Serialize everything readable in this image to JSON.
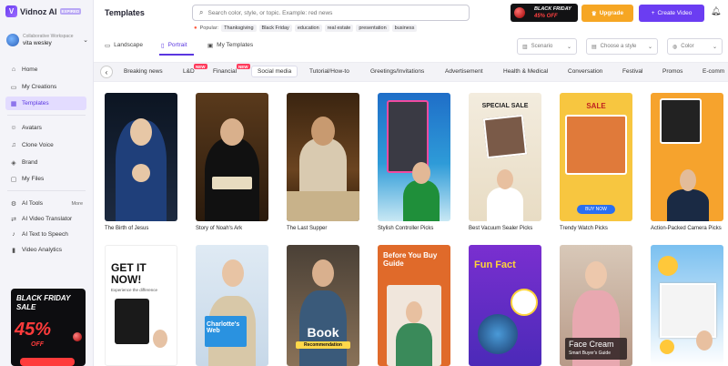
{
  "app": {
    "brand": "Vidnoz AI",
    "brand_badge": "EXPIRED",
    "workspace_label": "Collaborative Workspace",
    "user_name": "vita wesley"
  },
  "sidebar": {
    "items": [
      {
        "label": "Home",
        "icon": "home-icon"
      },
      {
        "label": "My Creations",
        "icon": "folder-icon"
      },
      {
        "label": "Templates",
        "icon": "templates-icon",
        "active": true
      },
      {
        "label": "Avatars",
        "icon": "avatar-icon"
      },
      {
        "label": "Clone Voice",
        "icon": "voice-icon"
      },
      {
        "label": "Brand",
        "icon": "brand-icon"
      },
      {
        "label": "My Files",
        "icon": "files-icon"
      },
      {
        "label": "AI Tools",
        "icon": "tools-icon",
        "more": "More"
      },
      {
        "label": "AI Video Translator",
        "icon": "translate-icon"
      },
      {
        "label": "AI Text to Speech",
        "icon": "speech-icon"
      },
      {
        "label": "Video Analytics",
        "icon": "analytics-icon"
      }
    ],
    "promo": {
      "line1": "BLACK FRIDAY",
      "line2": "SALE",
      "percent": "45%",
      "off": "OFF"
    }
  },
  "header": {
    "title": "Templates",
    "search_placeholder": "Search color, style, or topic. Example: red news",
    "popular_label": "Popular:",
    "popular_tags": [
      "Thanksgiving",
      "Black Friday",
      "education",
      "real estate",
      "presentation",
      "business"
    ],
    "promo_badge": {
      "line1": "BLACK FRIDAY",
      "line2": "45% OFF"
    },
    "upgrade_label": "Upgrade",
    "create_label": "Create Video"
  },
  "orientation": {
    "landscape": "Landscape",
    "portrait": "Portrait",
    "my_templates": "My Templates"
  },
  "filters": {
    "scenario": "Scenario",
    "style": "Choose a style",
    "color": "Color"
  },
  "categories": [
    {
      "label": "Breaking news"
    },
    {
      "label": "L&D",
      "badge": "NEW"
    },
    {
      "label": "Financial",
      "badge": "NEW"
    },
    {
      "label": "Social media",
      "active": true
    },
    {
      "label": "Tutorial/How-to"
    },
    {
      "label": "Greetings/Invitations"
    },
    {
      "label": "Advertisement"
    },
    {
      "label": "Health & Medical"
    },
    {
      "label": "Conversation"
    },
    {
      "label": "Festival"
    },
    {
      "label": "Promos"
    },
    {
      "label": "E-comm"
    }
  ],
  "templates": {
    "row1": [
      {
        "label": "The Birth of Jesus"
      },
      {
        "label": "Story of Noah's Ark"
      },
      {
        "label": "The Last Supper"
      },
      {
        "label": "Stylish Controller Picks"
      },
      {
        "label": "Best Vacuum Sealer Picks",
        "overlay": "SPECIAL SALE"
      },
      {
        "label": "Trendy Watch Picks",
        "overlay": "SALE",
        "cta": "BUY NOW"
      },
      {
        "label": "Action-Packed Camera Picks"
      }
    ],
    "row2": [
      {
        "overlay": "GET IT NOW!",
        "sub": "Experience the difference"
      },
      {
        "overlay": "Charlotte's Web"
      },
      {
        "overlay": "Book",
        "sub": "Recommendation"
      },
      {
        "overlay": "Before You Buy Guide"
      },
      {
        "overlay": "Fun Fact"
      },
      {
        "overlay": "Face Cream",
        "sub": "Smart Buyer's Guide"
      },
      {}
    ]
  }
}
